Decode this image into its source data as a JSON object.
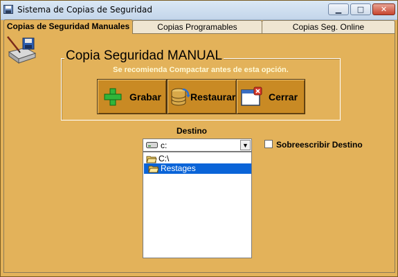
{
  "window": {
    "title": "Sistema de Copias de Seguridad"
  },
  "controls": {
    "minimize": "▁",
    "maximize": "□",
    "close": "✕"
  },
  "tabs": [
    {
      "label": "Copias de Seguridad Manuales",
      "active": true
    },
    {
      "label": "Copias Programables",
      "active": false
    },
    {
      "label": "Copias Seg. Online",
      "active": false
    }
  ],
  "group": {
    "title": "Copia Seguridad MANUAL",
    "hint": "Se recomienda Compactar antes de esta opción."
  },
  "buttons": {
    "grabar": {
      "label": "Grabar",
      "icon": "plus-icon"
    },
    "restaurar": {
      "label": "Restaurar",
      "icon": "database-restore-icon"
    },
    "cerrar": {
      "label": "Cerrar",
      "icon": "close-window-icon"
    }
  },
  "destino": {
    "label": "Destino",
    "drive": "c:",
    "folders": [
      "C:\\",
      "Restages"
    ],
    "selected": "Restages"
  },
  "overwrite": {
    "label": "Sobreescribir Destino",
    "checked": false
  },
  "colors": {
    "background": "#e3b25a",
    "button": "#c98a24",
    "selection": "#0a64d8",
    "hint_text": "#fff9d6"
  }
}
